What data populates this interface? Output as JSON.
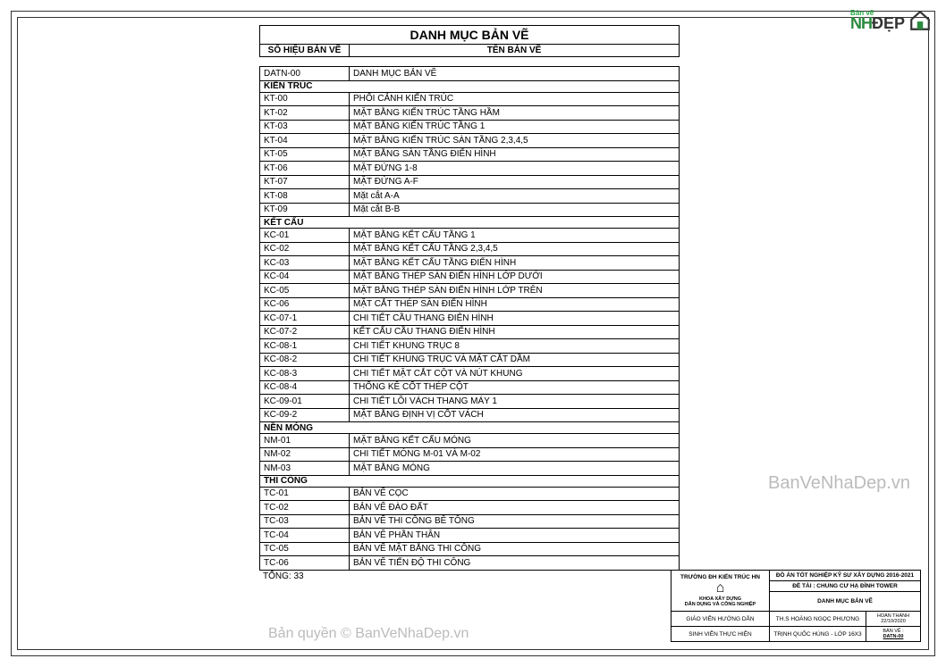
{
  "header": {
    "title": "DANH MỤC BẢN VẼ",
    "col_id": "SỐ HIỆU BẢN VẼ",
    "col_name": "TÊN BẢN VẼ"
  },
  "intro_row": {
    "id": "DATN-00",
    "name": "DANH MỤC BẢN VẼ"
  },
  "groups": [
    {
      "title": "KIẾN TRÚC",
      "rows": [
        {
          "id": "KT-00",
          "name": "PHỐI CẢNH KIẾN TRÚC"
        },
        {
          "id": "KT-02",
          "name": "MẶT BẰNG KIẾN TRÚC TẦNG HẦM"
        },
        {
          "id": "KT-03",
          "name": "MẶT BẰNG KIẾN TRÚC TẦNG 1"
        },
        {
          "id": "KT-04",
          "name": "MẶT BẰNG KIẾN TRÚC SÀN TẦNG 2,3,4,5"
        },
        {
          "id": "KT-05",
          "name": "MẶT BẰNG SÀN TẦNG ĐIỂN HÌNH"
        },
        {
          "id": "KT-06",
          "name": "MẶT ĐỨNG 1-8"
        },
        {
          "id": "KT-07",
          "name": "MẶT ĐỨNG A-F"
        },
        {
          "id": "KT-08",
          "name": "Mặt cắt A-A"
        },
        {
          "id": "KT-09",
          "name": "Mặt cắt B-B"
        }
      ]
    },
    {
      "title": "KẾT CẤU",
      "rows": [
        {
          "id": "KC-01",
          "name": "MẶT BẰNG KẾT CẤU TẦNG 1"
        },
        {
          "id": "KC-02",
          "name": "MẶT BẰNG KẾT CẤU TẦNG 2,3,4,5"
        },
        {
          "id": "KC-03",
          "name": "MẶT BẰNG KẾT CẤU TẦNG ĐIỂN HÌNH"
        },
        {
          "id": "KC-04",
          "name": "MẶT BẰNG THÉP SÀN ĐIỂN HÌNH LỚP DƯỚI"
        },
        {
          "id": "KC-05",
          "name": "MẶT BẰNG THÉP SÀN ĐIỂN HÌNH LỚP TRÊN"
        },
        {
          "id": "KC-06",
          "name": "MẶT CẮT THÉP SÀN ĐIỂN HÌNH"
        },
        {
          "id": "KC-07-1",
          "name": "CHI TIẾT CẦU THANG ĐIỂN HÌNH"
        },
        {
          "id": "KC-07-2",
          "name": "KẾT CẤU CẦU THANG ĐIỂN HÌNH"
        },
        {
          "id": "KC-08-1",
          "name": "CHI TIẾT KHUNG TRỤC 8"
        },
        {
          "id": "KC-08-2",
          "name": "CHI TIẾT KHUNG TRỤC VÀ MẶT CẮT DẦM"
        },
        {
          "id": "KC-08-3",
          "name": "CHI TIẾT MẶT CẮT CỘT VÀ NÚT KHUNG"
        },
        {
          "id": "KC-08-4",
          "name": "THỐNG KÊ CỐT THÉP CỘT"
        },
        {
          "id": "KC-09-01",
          "name": "CHI TIẾT LÕI VÁCH THANG MÁY 1"
        },
        {
          "id": "KC-09-2",
          "name": "MẶT BẰNG ĐỊNH VỊ CỐT VÁCH"
        }
      ]
    },
    {
      "title": "NỀN MÓNG",
      "rows": [
        {
          "id": "NM-01",
          "name": "MẶT BẰNG KẾT CẤU MÓNG"
        },
        {
          "id": "NM-02",
          "name": "CHI TIẾT MÓNG M-01 VÀ M-02"
        },
        {
          "id": "NM-03",
          "name": "MẶT BẰNG MÓNG"
        }
      ]
    },
    {
      "title": "THI CÔNG",
      "rows": [
        {
          "id": "TC-01",
          "name": "BẢN VẼ CỌC"
        },
        {
          "id": "TC-02",
          "name": "BẢN VẼ ĐÀO ĐẤT"
        },
        {
          "id": "TC-03",
          "name": "BẢN VẼ THI CÔNG BÊ TÔNG"
        },
        {
          "id": "TC-04",
          "name": "BẢN VẼ PHẦN THÂN"
        },
        {
          "id": "TC-05",
          "name": "BẢN VẼ MẶT BẰNG THI CÔNG"
        },
        {
          "id": "TC-06",
          "name": "BẢN VẼ TIẾN ĐỘ THI CÔNG"
        }
      ]
    }
  ],
  "total_label": "TỔNG: 33",
  "title_block": {
    "school": "TRƯỜNG ĐH KIẾN TRÚC HN",
    "dept1": "KHOA XÂY DỰNG",
    "dept2": "DÂN DỤNG VÀ CÔNG NGHIỆP",
    "project_label": "ĐỒ ÁN TỐT NGHIỆP KỸ SƯ XÂY DỰNG 2016-2021",
    "topic_label": "ĐỀ TÀI : CHUNG CƯ HẠ ĐÌNH TOWER",
    "sheet_title": "DANH MỤC BẢN VẼ",
    "gvhd_label": "GIÁO VIÊN HƯỚNG DẪN",
    "gvhd_value": "TH.S HOÀNG NGỌC PHƯƠNG",
    "date_label": "HOÀN THÀNH 22/10/2020",
    "svth_label": "SINH VIÊN THỰC HIỆN",
    "svth_value": "TRỊNH QUỐC HÙNG - LỚP 16X3",
    "sheet_no_label": "BẢN VẼ :",
    "sheet_no": "DATN-00"
  },
  "logo": {
    "pre": "Bản vẽ",
    "nh": "NH",
    "dep": "ĐẸP"
  },
  "watermarks": {
    "wm1": "BanVeNhaDep.vn",
    "wm2": "Bản quyền © BanVeNhaDep.vn"
  }
}
